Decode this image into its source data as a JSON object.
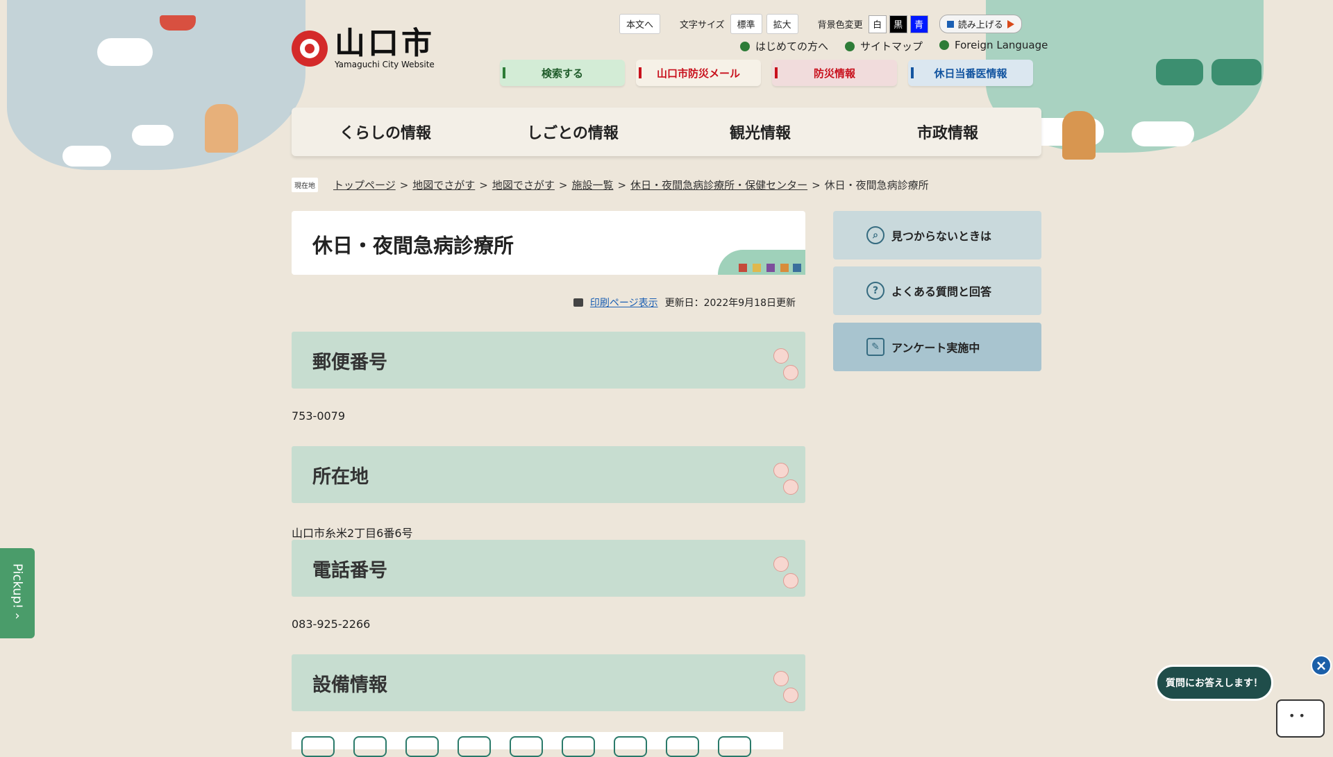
{
  "colors": {
    "accent_green": "#2d7c37",
    "accent_red": "#c8101c",
    "accent_blue": "#1355a0",
    "section_bg": "#c7ddd0"
  },
  "header": {
    "logo_title": "山口市",
    "logo_sub": "Yamaguchi City Website",
    "skip_link": "本文へ",
    "font_size_label": "文字サイズ",
    "font_standard": "標準",
    "font_large": "拡大",
    "bg_label": "背景色変更",
    "bg_white": "白",
    "bg_black": "黒",
    "bg_blue": "青",
    "read_aloud": "読み上げる",
    "links": [
      "はじめての方へ",
      "サイトマップ",
      "Foreign Language"
    ],
    "quick": [
      "検索する",
      "山口市防災メール",
      "防災情報",
      "休日当番医情報"
    ]
  },
  "gnav": [
    "くらしの情報",
    "しごとの情報",
    "観光情報",
    "市政情報"
  ],
  "breadcrumb": {
    "tag": "現在地",
    "items": [
      "トップページ",
      "地図でさがす",
      "地図でさがす",
      "施設一覧",
      "休日・夜間急病診療所・保健センター"
    ],
    "current": "休日・夜間急病診療所"
  },
  "page": {
    "title": "休日・夜間急病診療所",
    "print_link": "印刷ページ表示",
    "updated": "更新日：2022年9月18日更新",
    "sections": [
      {
        "heading": "郵便番号",
        "body": "753-0079"
      },
      {
        "heading": "所在地",
        "body": "山口市糸米2丁目6番6号"
      },
      {
        "heading": "電話番号",
        "body": "083-925-2266"
      },
      {
        "heading": "設備情報",
        "body": ""
      }
    ]
  },
  "side": [
    "見つからないときは",
    "よくある質問と回答",
    "アンケート実施中"
  ],
  "pickup": "Pickup!",
  "chat": {
    "bubble": "質問にお答えします！",
    "close": "×"
  }
}
